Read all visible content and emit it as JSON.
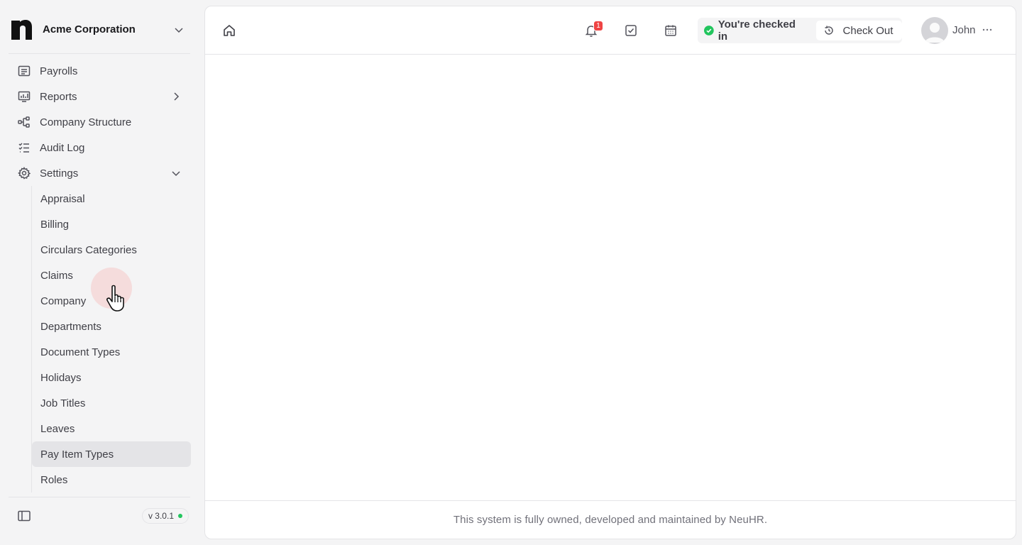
{
  "sidebar": {
    "org_name": "Acme Corporation",
    "nav": [
      {
        "label": "Payrolls",
        "icon": "payroll-icon"
      },
      {
        "label": "Reports",
        "icon": "reports-icon"
      },
      {
        "label": "Company Structure",
        "icon": "structure-icon"
      },
      {
        "label": "Audit Log",
        "icon": "audit-log-icon"
      },
      {
        "label": "Settings",
        "icon": "gear-icon"
      }
    ],
    "settings_items": [
      "Appraisal",
      "Billing",
      "Circulars Categories",
      "Claims",
      "Company",
      "Departments",
      "Document Types",
      "Holidays",
      "Job Titles",
      "Leaves",
      "Pay Item Types",
      "Roles"
    ],
    "active_item": "Pay Item Types",
    "version": "v 3.0.1"
  },
  "topbar": {
    "notification_count": "1",
    "checkin_status": "You're checked in",
    "checkout_label": "Check Out",
    "user_name": "John"
  },
  "footer": {
    "text": "This system is fully owned, developed and maintained by NeuHR."
  },
  "colors": {
    "sidebar_bg": "#f4f4f5",
    "active_bg": "#e4e4e7",
    "badge": "#ef4444",
    "success": "#22c55e"
  }
}
